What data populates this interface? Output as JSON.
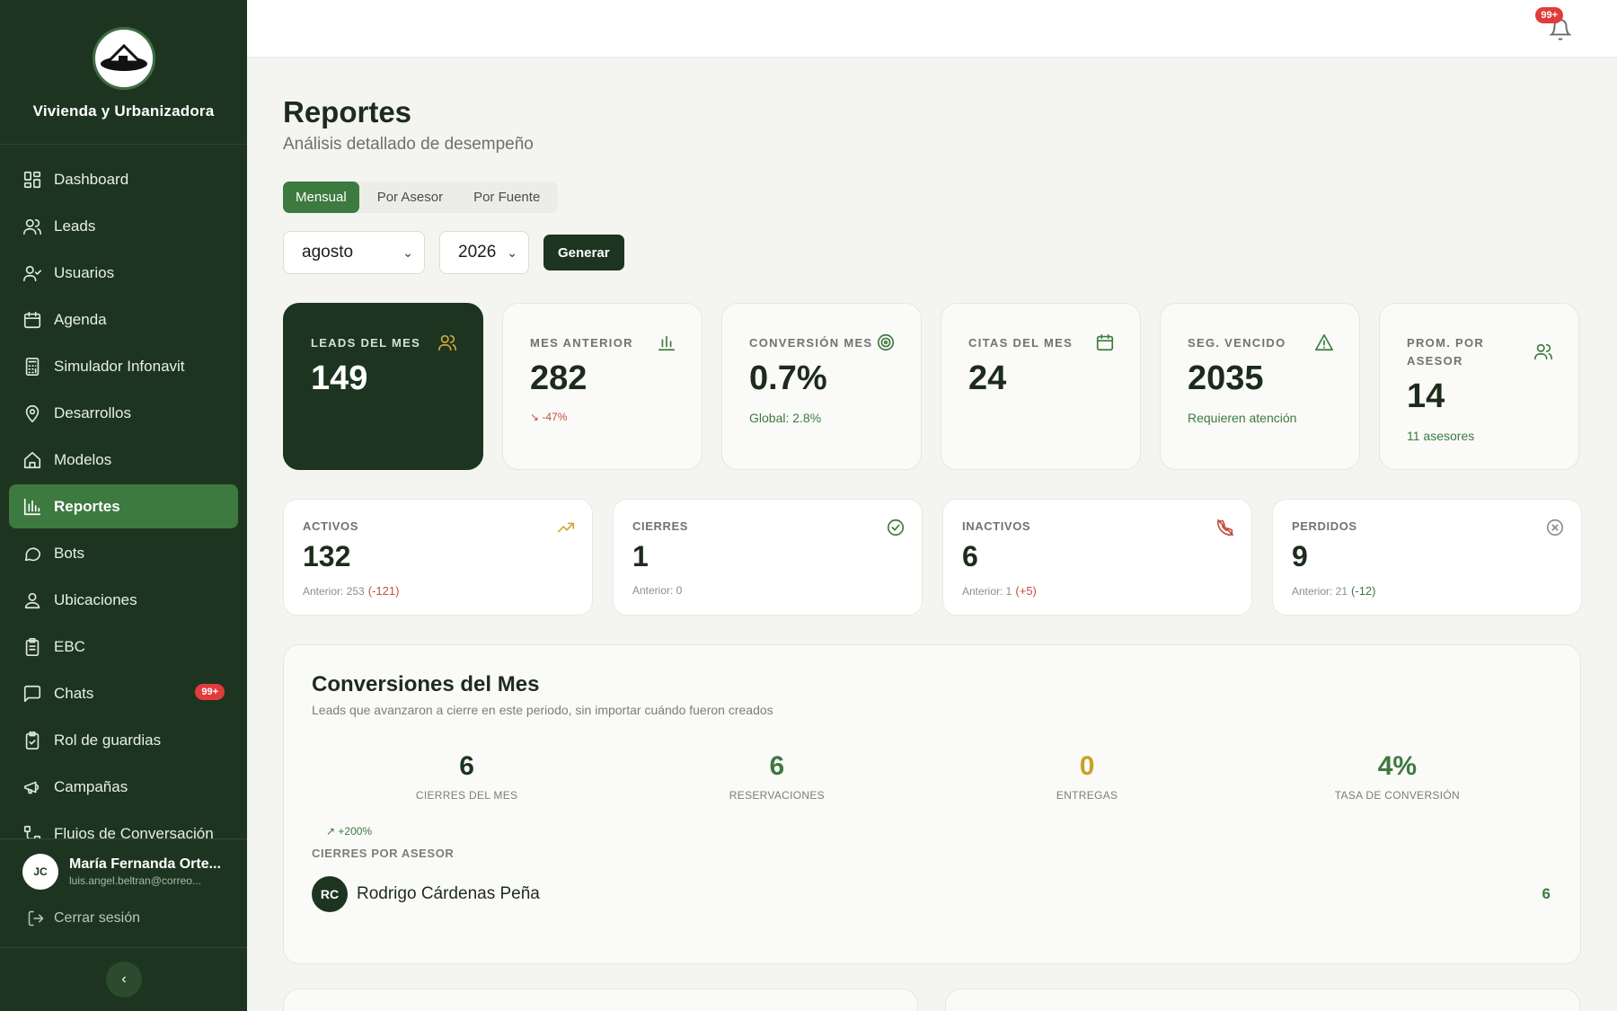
{
  "app": {
    "brand_name": "Vivienda y Urbanizadora"
  },
  "sidebar": {
    "items": [
      {
        "label": "Dashboard",
        "icon": "dashboard-icon"
      },
      {
        "label": "Leads",
        "icon": "users-icon"
      },
      {
        "label": "Usuarios",
        "icon": "user-check-icon"
      },
      {
        "label": "Agenda",
        "icon": "calendar-icon"
      },
      {
        "label": "Simulador Infonavit",
        "icon": "calculator-icon"
      },
      {
        "label": "Desarrollos",
        "icon": "map-pin-icon"
      },
      {
        "label": "Modelos",
        "icon": "house-icon"
      },
      {
        "label": "Reportes",
        "icon": "bar-chart-icon",
        "active": true
      },
      {
        "label": "Bots",
        "icon": "chat-bubble-icon"
      },
      {
        "label": "Ubicaciones",
        "icon": "user-pin-icon"
      },
      {
        "label": "EBC",
        "icon": "clipboard-icon"
      },
      {
        "label": "Chats",
        "icon": "message-square-icon",
        "badge": "99+"
      },
      {
        "label": "Rol de guardias",
        "icon": "clipboard-check-icon"
      },
      {
        "label": "Campañas",
        "icon": "megaphone-icon"
      },
      {
        "label": "Flujos de Conversación",
        "icon": "flow-icon"
      }
    ],
    "user": {
      "initials": "JC",
      "name": "María Fernanda Orte...",
      "email": "luis.angel.beltran@correo..."
    },
    "logout_label": "Cerrar sesión",
    "collapse_glyph": "‹"
  },
  "topbar": {
    "notification_badge": "99+"
  },
  "page": {
    "title": "Reportes",
    "subtitle": "Análisis detallado de desempeño",
    "tabs": [
      "Mensual",
      "Por Asesor",
      "Por Fuente"
    ],
    "month_select": "agosto",
    "year_select": "2026",
    "generate_label": "Generar"
  },
  "kpis": [
    {
      "label": "LEADS DEL MES",
      "value": "149",
      "note": "",
      "icon": "users-icon"
    },
    {
      "label": "MES ANTERIOR",
      "value": "282",
      "note": "↘ -47%",
      "icon": "bar-chart-icon"
    },
    {
      "label": "CONVERSIÓN MES",
      "value": "0.7%",
      "note": "Global: 2.8%",
      "icon": "target-icon"
    },
    {
      "label": "CITAS DEL MES",
      "value": "24",
      "note": "",
      "icon": "calendar-icon"
    },
    {
      "label": "SEG. VENCIDO",
      "value": "2035",
      "note": "Requieren atención",
      "icon": "warning-icon"
    },
    {
      "label": "PROM. POR ASESOR",
      "value": "14",
      "note": "11 asesores",
      "icon": "users-icon"
    }
  ],
  "stats": [
    {
      "label": "ACTIVOS",
      "value": "132",
      "prev": "Anterior: 253",
      "delta": "(-121)",
      "icon": "trending-up-icon",
      "color": "#d4a73a"
    },
    {
      "label": "CIERRES",
      "value": "1",
      "prev": "Anterior: 0",
      "delta": "",
      "icon": "check-circle-icon",
      "color": "#3d7a3f"
    },
    {
      "label": "INACTIVOS",
      "value": "6",
      "prev": "Anterior: 1",
      "delta": "(+5)",
      "icon": "phone-off-icon",
      "color": "#c0503b"
    },
    {
      "label": "PERDIDOS",
      "value": "9",
      "prev": "Anterior: 21",
      "delta": "(-12)",
      "icon": "x-circle-icon",
      "color": "#8a8f8a"
    }
  ],
  "conversions": {
    "title": "Conversiones del Mes",
    "subtitle": "Leads que avanzaron a cierre en este periodo, sin importar cuándo fueron creados",
    "metrics": [
      {
        "value": "6",
        "label": "CIERRES DEL MES",
        "color": "#1d3520"
      },
      {
        "value": "6",
        "label": "RESERVACIONES",
        "color": "#3d7a3f"
      },
      {
        "value": "0",
        "label": "ENTREGAS",
        "color": "#c9a227"
      },
      {
        "value": "4%",
        "label": "TASA DE CONVERSIÓN",
        "color": "#3d7a3f"
      }
    ],
    "trend": "↗ +200%",
    "by_advisor_label": "CIERRES POR ASESOR",
    "advisor": {
      "initials": "RC",
      "name": "Rodrigo Cárdenas Peña",
      "count": "6"
    }
  },
  "colors": {
    "sidebar_bg": "#1d3520",
    "accent_green": "#3d7a3f",
    "badge_red": "#e23b3b"
  }
}
